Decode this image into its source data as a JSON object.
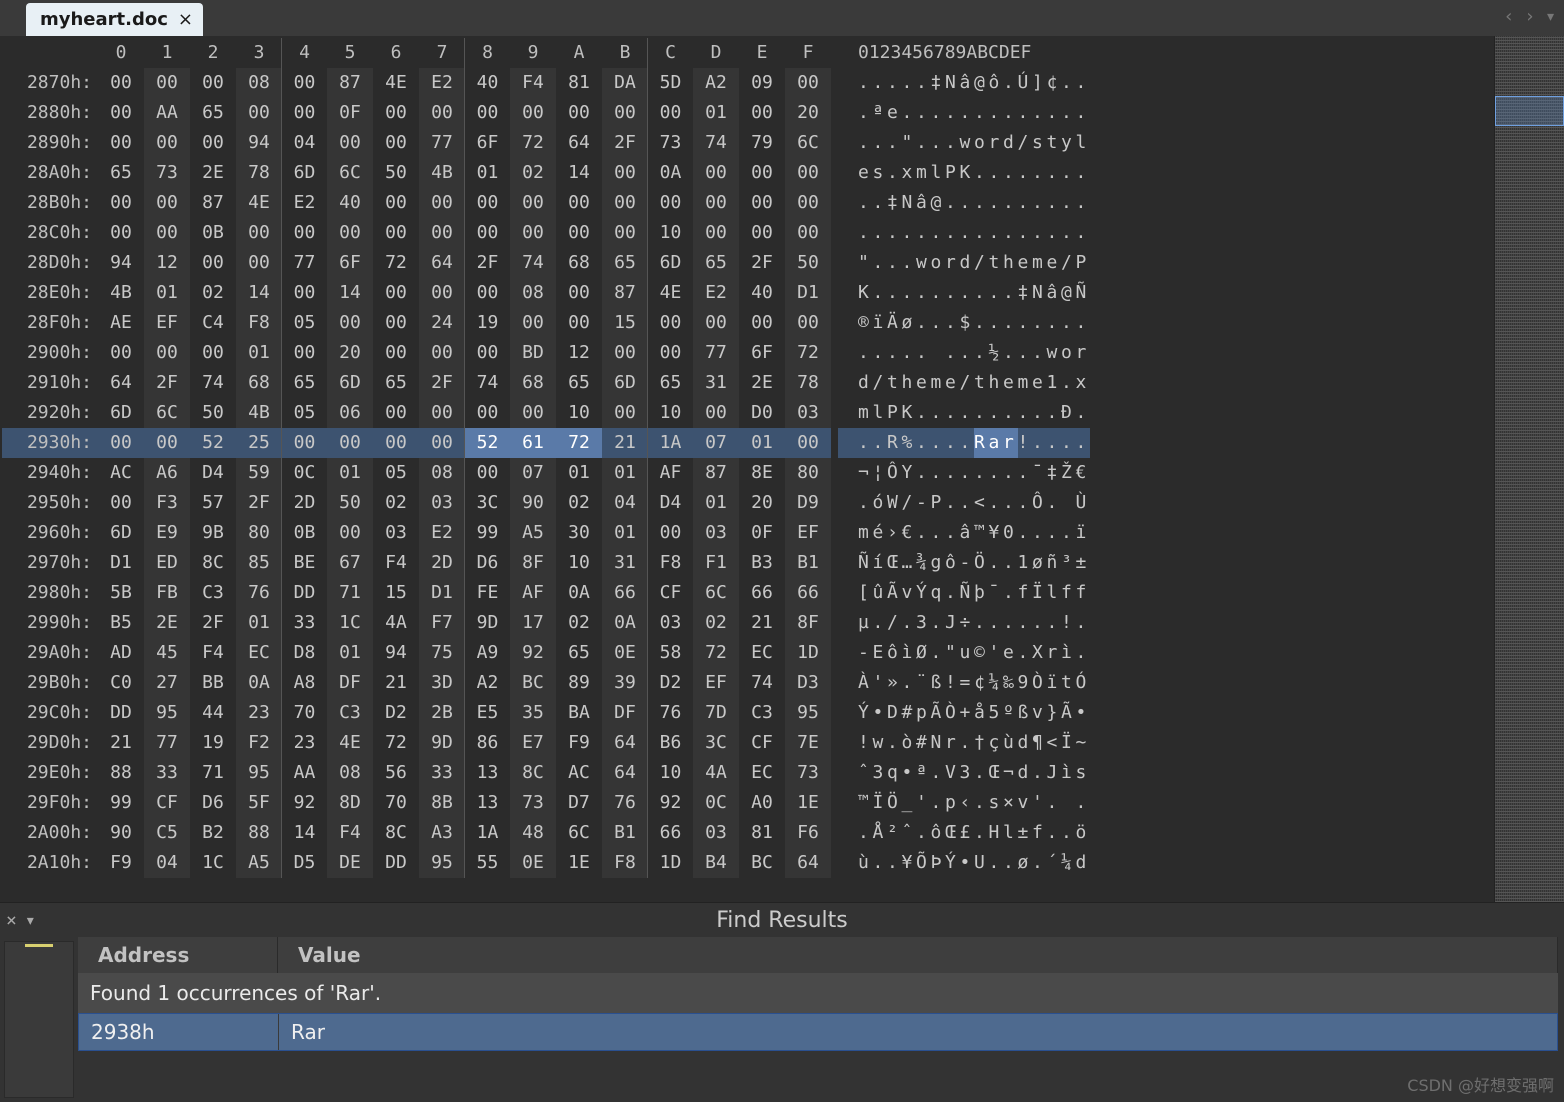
{
  "tab": {
    "filename": "myheart.doc",
    "close_glyph": "×"
  },
  "nav": {
    "back": "‹",
    "forward": "›",
    "menu": "▾"
  },
  "hex": {
    "header_offsets": [
      "0",
      "1",
      "2",
      "3",
      "4",
      "5",
      "6",
      "7",
      "8",
      "9",
      "A",
      "B",
      "C",
      "D",
      "E",
      "F"
    ],
    "ascii_header": "0123456789ABCDEF",
    "rows": [
      {
        "addr": "2870h",
        "bytes": [
          "00",
          "00",
          "00",
          "08",
          "00",
          "87",
          "4E",
          "E2",
          "40",
          "F4",
          "81",
          "DA",
          "5D",
          "A2",
          "09",
          "00"
        ],
        "ascii": ".....‡Nâ@ô.Ú]¢.."
      },
      {
        "addr": "2880h",
        "bytes": [
          "00",
          "AA",
          "65",
          "00",
          "00",
          "0F",
          "00",
          "00",
          "00",
          "00",
          "00",
          "00",
          "00",
          "01",
          "00",
          "20"
        ],
        "ascii": ".ªe............."
      },
      {
        "addr": "2890h",
        "bytes": [
          "00",
          "00",
          "00",
          "94",
          "04",
          "00",
          "00",
          "77",
          "6F",
          "72",
          "64",
          "2F",
          "73",
          "74",
          "79",
          "6C"
        ],
        "ascii": "...\"...word/styl"
      },
      {
        "addr": "28A0h",
        "bytes": [
          "65",
          "73",
          "2E",
          "78",
          "6D",
          "6C",
          "50",
          "4B",
          "01",
          "02",
          "14",
          "00",
          "0A",
          "00",
          "00",
          "00"
        ],
        "ascii": "es.xmlPK........"
      },
      {
        "addr": "28B0h",
        "bytes": [
          "00",
          "00",
          "87",
          "4E",
          "E2",
          "40",
          "00",
          "00",
          "00",
          "00",
          "00",
          "00",
          "00",
          "00",
          "00",
          "00"
        ],
        "ascii": "..‡Nâ@.........."
      },
      {
        "addr": "28C0h",
        "bytes": [
          "00",
          "00",
          "0B",
          "00",
          "00",
          "00",
          "00",
          "00",
          "00",
          "00",
          "00",
          "00",
          "10",
          "00",
          "00",
          "00"
        ],
        "ascii": "................"
      },
      {
        "addr": "28D0h",
        "bytes": [
          "94",
          "12",
          "00",
          "00",
          "77",
          "6F",
          "72",
          "64",
          "2F",
          "74",
          "68",
          "65",
          "6D",
          "65",
          "2F",
          "50"
        ],
        "ascii": "\"...word/theme/P"
      },
      {
        "addr": "28E0h",
        "bytes": [
          "4B",
          "01",
          "02",
          "14",
          "00",
          "14",
          "00",
          "00",
          "00",
          "08",
          "00",
          "87",
          "4E",
          "E2",
          "40",
          "D1"
        ],
        "ascii": "K..........‡Nâ@Ñ"
      },
      {
        "addr": "28F0h",
        "bytes": [
          "AE",
          "EF",
          "C4",
          "F8",
          "05",
          "00",
          "00",
          "24",
          "19",
          "00",
          "00",
          "15",
          "00",
          "00",
          "00",
          "00"
        ],
        "ascii": "®ïÄø...$........"
      },
      {
        "addr": "2900h",
        "bytes": [
          "00",
          "00",
          "00",
          "01",
          "00",
          "20",
          "00",
          "00",
          "00",
          "BD",
          "12",
          "00",
          "00",
          "77",
          "6F",
          "72"
        ],
        "ascii": "..... ...½...wor"
      },
      {
        "addr": "2910h",
        "bytes": [
          "64",
          "2F",
          "74",
          "68",
          "65",
          "6D",
          "65",
          "2F",
          "74",
          "68",
          "65",
          "6D",
          "65",
          "31",
          "2E",
          "78"
        ],
        "ascii": "d/theme/theme1.x"
      },
      {
        "addr": "2920h",
        "bytes": [
          "6D",
          "6C",
          "50",
          "4B",
          "05",
          "06",
          "00",
          "00",
          "00",
          "00",
          "10",
          "00",
          "10",
          "00",
          "D0",
          "03"
        ],
        "ascii": "mlPK..........Ð."
      },
      {
        "addr": "2930h",
        "bytes": [
          "00",
          "00",
          "52",
          "25",
          "00",
          "00",
          "00",
          "00",
          "52",
          "61",
          "72",
          "21",
          "1A",
          "07",
          "01",
          "00"
        ],
        "ascii": "..R%....Rar!....",
        "highlight": true,
        "sel_bytes": [
          8,
          9,
          10
        ],
        "sel_ascii": [
          8,
          9,
          10
        ]
      },
      {
        "addr": "2940h",
        "bytes": [
          "AC",
          "A6",
          "D4",
          "59",
          "0C",
          "01",
          "05",
          "08",
          "00",
          "07",
          "01",
          "01",
          "AF",
          "87",
          "8E",
          "80"
        ],
        "ascii": "¬¦ÔY........¯‡Ž€"
      },
      {
        "addr": "2950h",
        "bytes": [
          "00",
          "F3",
          "57",
          "2F",
          "2D",
          "50",
          "02",
          "03",
          "3C",
          "90",
          "02",
          "04",
          "D4",
          "01",
          "20",
          "D9"
        ],
        "ascii": ".óW/-P..<...Ô. Ù"
      },
      {
        "addr": "2960h",
        "bytes": [
          "6D",
          "E9",
          "9B",
          "80",
          "0B",
          "00",
          "03",
          "E2",
          "99",
          "A5",
          "30",
          "01",
          "00",
          "03",
          "0F",
          "EF"
        ],
        "ascii": "mé›€...â™¥0....ï"
      },
      {
        "addr": "2970h",
        "bytes": [
          "D1",
          "ED",
          "8C",
          "85",
          "BE",
          "67",
          "F4",
          "2D",
          "D6",
          "8F",
          "10",
          "31",
          "F8",
          "F1",
          "B3",
          "B1"
        ],
        "ascii": "ÑíŒ…¾gô-Ö..1øñ³±"
      },
      {
        "addr": "2980h",
        "bytes": [
          "5B",
          "FB",
          "C3",
          "76",
          "DD",
          "71",
          "15",
          "D1",
          "FE",
          "AF",
          "0A",
          "66",
          "CF",
          "6C",
          "66",
          "66"
        ],
        "ascii": "[ûÃvÝq.Ñþ¯.fÏlff"
      },
      {
        "addr": "2990h",
        "bytes": [
          "B5",
          "2E",
          "2F",
          "01",
          "33",
          "1C",
          "4A",
          "F7",
          "9D",
          "17",
          "02",
          "0A",
          "03",
          "02",
          "21",
          "8F"
        ],
        "ascii": "µ./.3.J÷......!."
      },
      {
        "addr": "29A0h",
        "bytes": [
          "AD",
          "45",
          "F4",
          "EC",
          "D8",
          "01",
          "94",
          "75",
          "A9",
          "92",
          "65",
          "0E",
          "58",
          "72",
          "EC",
          "1D"
        ],
        "ascii": "-EôìØ.\"u©'e.Xrì."
      },
      {
        "addr": "29B0h",
        "bytes": [
          "C0",
          "27",
          "BB",
          "0A",
          "A8",
          "DF",
          "21",
          "3D",
          "A2",
          "BC",
          "89",
          "39",
          "D2",
          "EF",
          "74",
          "D3"
        ],
        "ascii": "À'».¨ß!=¢¼‰9ÒïtÓ"
      },
      {
        "addr": "29C0h",
        "bytes": [
          "DD",
          "95",
          "44",
          "23",
          "70",
          "C3",
          "D2",
          "2B",
          "E5",
          "35",
          "BA",
          "DF",
          "76",
          "7D",
          "C3",
          "95"
        ],
        "ascii": "Ý•D#pÃÒ+å5ºßv}Ã•"
      },
      {
        "addr": "29D0h",
        "bytes": [
          "21",
          "77",
          "19",
          "F2",
          "23",
          "4E",
          "72",
          "9D",
          "86",
          "E7",
          "F9",
          "64",
          "B6",
          "3C",
          "CF",
          "7E"
        ],
        "ascii": "!w.ò#Nr.†çùd¶<Ï~"
      },
      {
        "addr": "29E0h",
        "bytes": [
          "88",
          "33",
          "71",
          "95",
          "AA",
          "08",
          "56",
          "33",
          "13",
          "8C",
          "AC",
          "64",
          "10",
          "4A",
          "EC",
          "73"
        ],
        "ascii": "ˆ3q•ª.V3.Œ¬d.Jìs"
      },
      {
        "addr": "29F0h",
        "bytes": [
          "99",
          "CF",
          "D6",
          "5F",
          "92",
          "8D",
          "70",
          "8B",
          "13",
          "73",
          "D7",
          "76",
          "92",
          "0C",
          "A0",
          "1E"
        ],
        "ascii": "™ÏÖ_'.p‹.s×v'. ."
      },
      {
        "addr": "2A00h",
        "bytes": [
          "90",
          "C5",
          "B2",
          "88",
          "14",
          "F4",
          "8C",
          "A3",
          "1A",
          "48",
          "6C",
          "B1",
          "66",
          "03",
          "81",
          "F6"
        ],
        "ascii": ".Å²ˆ.ôŒ£.Hl±f..ö"
      },
      {
        "addr": "2A10h",
        "bytes": [
          "F9",
          "04",
          "1C",
          "A5",
          "D5",
          "DE",
          "DD",
          "95",
          "55",
          "0E",
          "1E",
          "F8",
          "1D",
          "B4",
          "BC",
          "64"
        ],
        "ascii": "ù..¥ÕÞÝ•U..ø.´¼d"
      }
    ]
  },
  "find": {
    "title": "Find Results",
    "col_address": "Address",
    "col_value": "Value",
    "status": "Found 1 occurrences of 'Rar'.",
    "result_addr": "2938h",
    "result_val": "Rar",
    "close_glyph": "×",
    "menu_glyph": "▾"
  },
  "watermark": "CSDN @好想变强啊"
}
